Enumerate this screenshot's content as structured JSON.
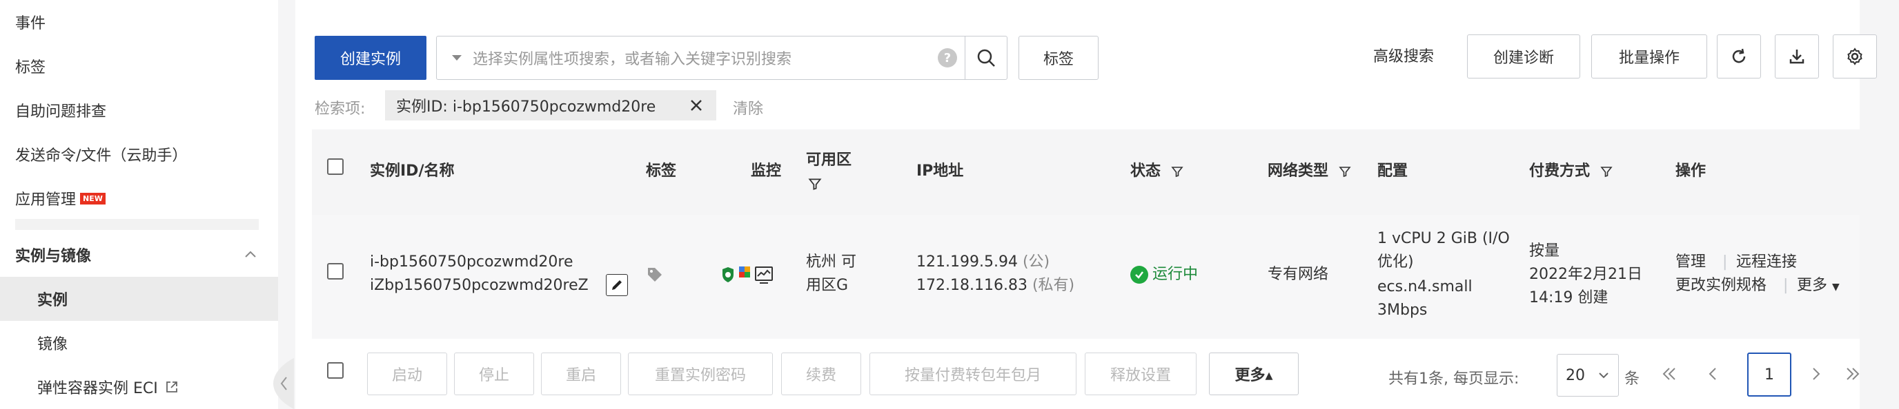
{
  "sidebar": {
    "items": [
      {
        "label": "事件"
      },
      {
        "label": "标签"
      },
      {
        "label": "自助问题排查"
      },
      {
        "label": "发送命令/文件（云助手）"
      },
      {
        "label": "应用管理",
        "badge": "NEW"
      }
    ],
    "group": {
      "label": "实例与镜像"
    },
    "subitems": [
      {
        "label": "实例",
        "active": true
      },
      {
        "label": "镜像"
      },
      {
        "label": "弹性容器实例 ECI"
      }
    ]
  },
  "toolbar": {
    "create_label": "创建实例",
    "search_placeholder": "选择实例属性项搜索，或者输入关键字识别搜索",
    "tag_label": "标签",
    "advanced_search": "高级搜索",
    "create_diagnosis": "创建诊断",
    "batch_ops": "批量操作"
  },
  "filter": {
    "label": "检索项:",
    "tag_text": "实例ID: i-bp1560750pcozwmd20re",
    "clear": "清除"
  },
  "table": {
    "headers": {
      "id_name": "实例ID/名称",
      "tags": "标签",
      "monitor": "监控",
      "zone_line1": "可用区",
      "ip": "IP地址",
      "status": "状态",
      "network": "网络类型",
      "config": "配置",
      "billing": "付费方式",
      "actions": "操作"
    },
    "row": {
      "instance_id": "i-bp1560750pcozwmd20re",
      "instance_name": "iZbp1560750pcozwmd20reZ",
      "zone_line1": "杭州 可",
      "zone_line2": "用区G",
      "ip_public": "121.199.5.94",
      "ip_public_tag": "(公)",
      "ip_private": "172.18.116.83",
      "ip_private_tag": "(私有)",
      "status": "运行中",
      "status_color": "#1fa83f",
      "network": "专有网络",
      "config_line1": "1 vCPU 2 GiB  (I/O",
      "config_line2": "优化)",
      "config_spec": "ecs.n4.small",
      "config_bw": "3Mbps",
      "billing_line1": "按量",
      "billing_line2": "2022年2月21日",
      "billing_line3": "14:19 创建",
      "action_manage": "管理",
      "action_remote": "远程连接",
      "action_resize": "更改实例规格",
      "action_more": "更多"
    }
  },
  "footer": {
    "buttons": [
      "启动",
      "停止",
      "重启",
      "重置实例密码",
      "续费",
      "按量付费转包年包月",
      "释放设置"
    ],
    "more": "更多▴",
    "total_text": "共有1条, 每页显示:",
    "page_size": "20",
    "unit": "条",
    "current_page": "1"
  },
  "colors": {
    "primary": "#2156b5",
    "link": "#2156b5",
    "success": "#1fa83f",
    "badge": "#e8311f"
  }
}
